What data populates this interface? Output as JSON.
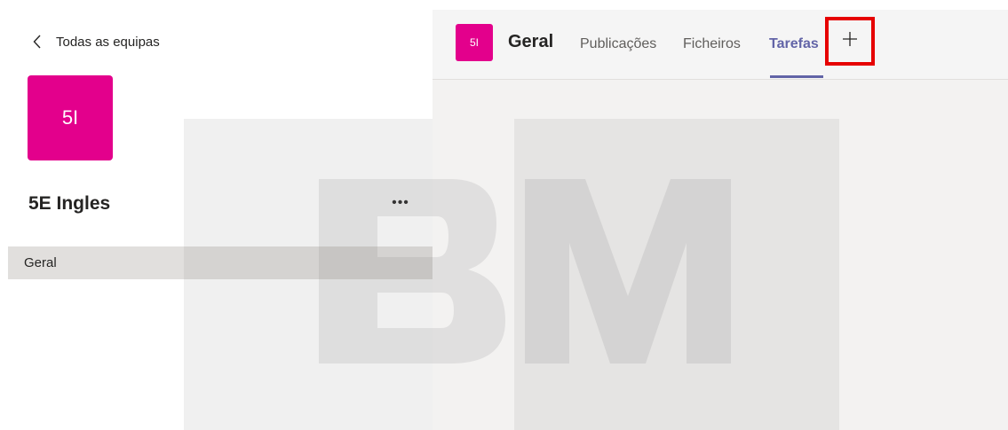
{
  "left_rail": {
    "back_label": "Todas as equipas",
    "team_initials": "5I",
    "team_name": "5E Ingles",
    "more_label": "•••",
    "channels": [
      {
        "label": "Geral"
      }
    ]
  },
  "channel": {
    "avatar_initials": "5I",
    "title": "Geral",
    "tabs": [
      {
        "label": "Publicações"
      },
      {
        "label": "Ficheiros"
      },
      {
        "label": "Tarefas"
      }
    ],
    "active_tab": "Tarefas"
  },
  "icons": {
    "back": "chevron-left-icon",
    "add_tab": "plus-icon",
    "more": "more-options-icon"
  },
  "colors": {
    "team_tile": "#e3008c",
    "accent": "#6264a7",
    "highlight_box": "#e60000",
    "channel_selected": "#e1dfdd"
  }
}
